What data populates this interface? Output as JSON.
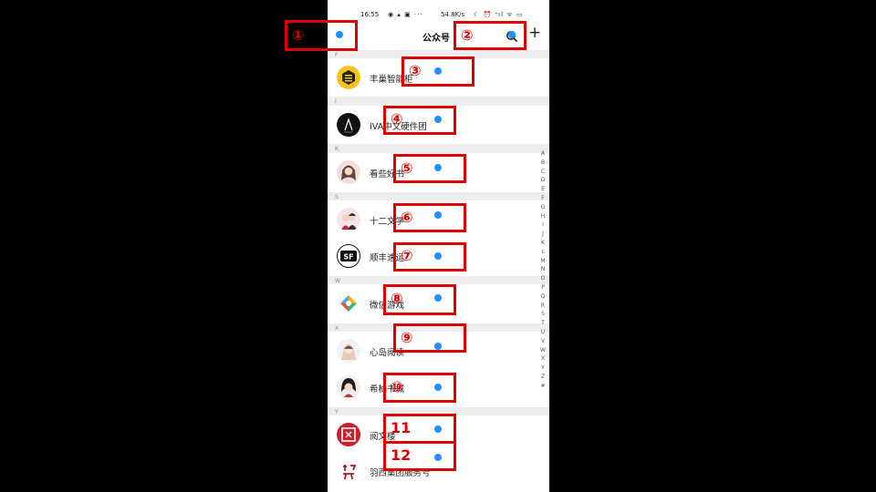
{
  "status_bar": {
    "time": "16:55",
    "extra": "◉ ▴ ▣ ···",
    "network": "54.8K/s",
    "icons": "☾ ⏰ ᐩıl ᯤ ▭"
  },
  "header": {
    "title": "公众号"
  },
  "sections": [
    "F",
    "I",
    "K",
    "S",
    "W",
    "X",
    "Y"
  ],
  "accounts": [
    {
      "name": "丰巢智能柜",
      "avatar": "yellow-hex-logo"
    },
    {
      "name": "IVA中文硬件团",
      "avatar": "black-brand-logo"
    },
    {
      "name": "看些好书",
      "avatar": "girl-portrait"
    },
    {
      "name": "十二文学",
      "avatar": "couple-portrait"
    },
    {
      "name": "顺丰速运",
      "avatar": "sf-logo"
    },
    {
      "name": "微信游戏",
      "avatar": "wechat-game-logo"
    },
    {
      "name": "心岛阅读",
      "avatar": "girl-portrait"
    },
    {
      "name": "希柚书城",
      "avatar": "girl-portrait"
    },
    {
      "name": "阅文楼",
      "avatar": "red-read-logo"
    },
    {
      "name": "羽西集团服务号",
      "avatar": "red-calligraphy-logo"
    }
  ],
  "index_letters": [
    "A",
    "B",
    "C",
    "D",
    "E",
    "F",
    "G",
    "H",
    "I",
    "J",
    "K",
    "L",
    "M",
    "N",
    "O",
    "P",
    "Q",
    "R",
    "S",
    "T",
    "U",
    "V",
    "W",
    "X",
    "Y",
    "Z",
    "#"
  ],
  "annotations": [
    "①",
    "②",
    "③",
    "④",
    "⑤",
    "⑥",
    "⑦",
    "⑧",
    "⑨",
    "⑩",
    "11",
    "12"
  ],
  "colors": {
    "annotation": "#e00000",
    "dot": "#1e90ff",
    "section_bg": "#ededed"
  }
}
